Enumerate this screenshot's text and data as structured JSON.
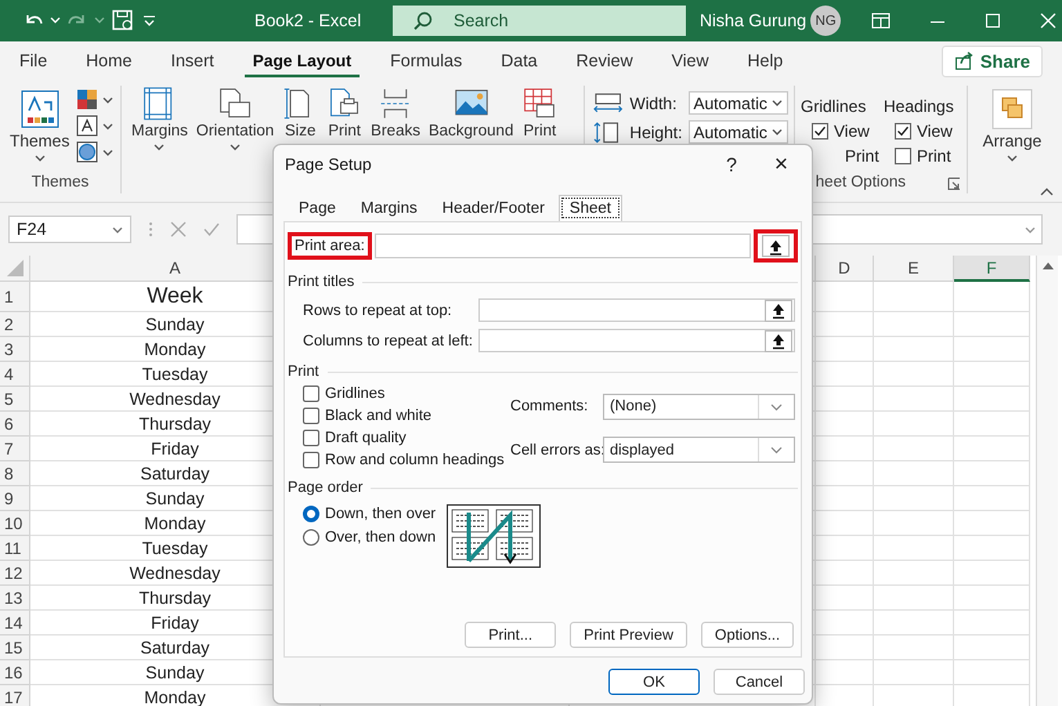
{
  "title_bar": {
    "title": "Book2 - Excel",
    "search": {
      "placeholder": "Search"
    },
    "user": "Nisha Gurung",
    "avatar": "NG"
  },
  "ribbon_tabs": [
    {
      "label": "File",
      "selected": false
    },
    {
      "label": "Home",
      "selected": false
    },
    {
      "label": "Insert",
      "selected": false
    },
    {
      "label": "Page Layout",
      "selected": true
    },
    {
      "label": "Formulas",
      "selected": false
    },
    {
      "label": "Data",
      "selected": false
    },
    {
      "label": "Review",
      "selected": false
    },
    {
      "label": "View",
      "selected": false
    },
    {
      "label": "Help",
      "selected": false
    }
  ],
  "share_button": "Share",
  "ribbon": {
    "themes_group": {
      "button": "Themes",
      "label": "Themes"
    },
    "page_setup_group": {
      "buttons": [
        {
          "label": "Margins",
          "menu": true
        },
        {
          "label": "Orientation",
          "menu": true
        },
        {
          "label": "Size"
        },
        {
          "label": "Print"
        },
        {
          "label": "Breaks"
        },
        {
          "label": "Background"
        },
        {
          "label": "Print"
        }
      ]
    },
    "scale_group": {
      "rows": [
        {
          "label": "Width:",
          "value": "Automatic"
        },
        {
          "label": "Height:",
          "value": "Automatic"
        }
      ]
    },
    "sheet_options_group": {
      "columns": [
        {
          "heading": "Gridlines",
          "options": [
            {
              "label": "View",
              "checked": true
            },
            {
              "label": "Print"
            }
          ]
        },
        {
          "heading": "Headings",
          "options": [
            {
              "label": "View",
              "checked": true
            },
            {
              "label": "Print",
              "checked": false
            }
          ]
        }
      ],
      "label": "heet Options"
    },
    "arrange_group": {
      "button": "Arrange"
    }
  },
  "formula_bar": {
    "name_box": "F24"
  },
  "sheet": {
    "columns": [
      {
        "label": "A",
        "selected": false
      },
      {
        "label": "D",
        "selected": false
      },
      {
        "label": "E",
        "selected": false
      },
      {
        "label": "F",
        "selected": true
      }
    ],
    "rows": [
      {
        "number": "1",
        "value": "Week",
        "kind": "heading"
      },
      {
        "number": "2",
        "value": "Sunday",
        "kind": "day"
      },
      {
        "number": "3",
        "value": "Monday",
        "kind": "day"
      },
      {
        "number": "4",
        "value": "Tuesday",
        "kind": "day"
      },
      {
        "number": "5",
        "value": "Wednesday",
        "kind": "day"
      },
      {
        "number": "6",
        "value": "Thursday",
        "kind": "day"
      },
      {
        "number": "7",
        "value": "Friday",
        "kind": "day"
      },
      {
        "number": "8",
        "value": "Saturday",
        "kind": "day"
      },
      {
        "number": "9",
        "value": "Sunday",
        "kind": "day"
      },
      {
        "number": "10",
        "value": "Monday",
        "kind": "day"
      },
      {
        "number": "11",
        "value": "Tuesday",
        "kind": "day"
      },
      {
        "number": "12",
        "value": "Wednesday",
        "kind": "day"
      },
      {
        "number": "13",
        "value": "Thursday",
        "kind": "day"
      },
      {
        "number": "14",
        "value": "Friday",
        "kind": "day"
      },
      {
        "number": "15",
        "value": "Saturday",
        "kind": "day"
      },
      {
        "number": "16",
        "value": "Sunday",
        "kind": "day"
      },
      {
        "number": "17",
        "value": "Monday",
        "kind": "day"
      }
    ]
  },
  "dialog": {
    "title": "Page Setup",
    "help": "?",
    "close": "×",
    "tabs": [
      {
        "label": "Page",
        "selected": false
      },
      {
        "label": "Margins",
        "selected": false
      },
      {
        "label": "Header/Footer",
        "selected": false
      },
      {
        "label": "Sheet",
        "selected": true
      }
    ],
    "print_area": {
      "label": "Print area:",
      "highlighted": true,
      "button_highlighted": true
    },
    "print_titles": {
      "heading": "Print titles",
      "fields": [
        {
          "label": "Rows to repeat at top:"
        },
        {
          "label": "Columns to repeat at left:"
        }
      ]
    },
    "print": {
      "heading": "Print",
      "options": [
        {
          "label": "Gridlines",
          "checked": false
        },
        {
          "label": "Black and white",
          "checked": false
        },
        {
          "label": "Draft quality",
          "checked": false
        },
        {
          "label": "Row and column headings",
          "checked": false
        }
      ],
      "selects": [
        {
          "label": "Comments:",
          "value": "(None)"
        },
        {
          "label": "Cell errors as:",
          "value": "displayed"
        }
      ]
    },
    "page_order": {
      "heading": "Page order",
      "options": [
        {
          "label": "Down, then over",
          "selected": true
        },
        {
          "label": "Over, then down",
          "selected": false
        }
      ]
    },
    "buttons": [
      {
        "label": "Print..."
      },
      {
        "label": "Print Preview"
      },
      {
        "label": "Options..."
      }
    ],
    "footer_buttons": [
      {
        "label": "OK",
        "default": true
      },
      {
        "label": "Cancel",
        "default": false
      }
    ]
  }
}
